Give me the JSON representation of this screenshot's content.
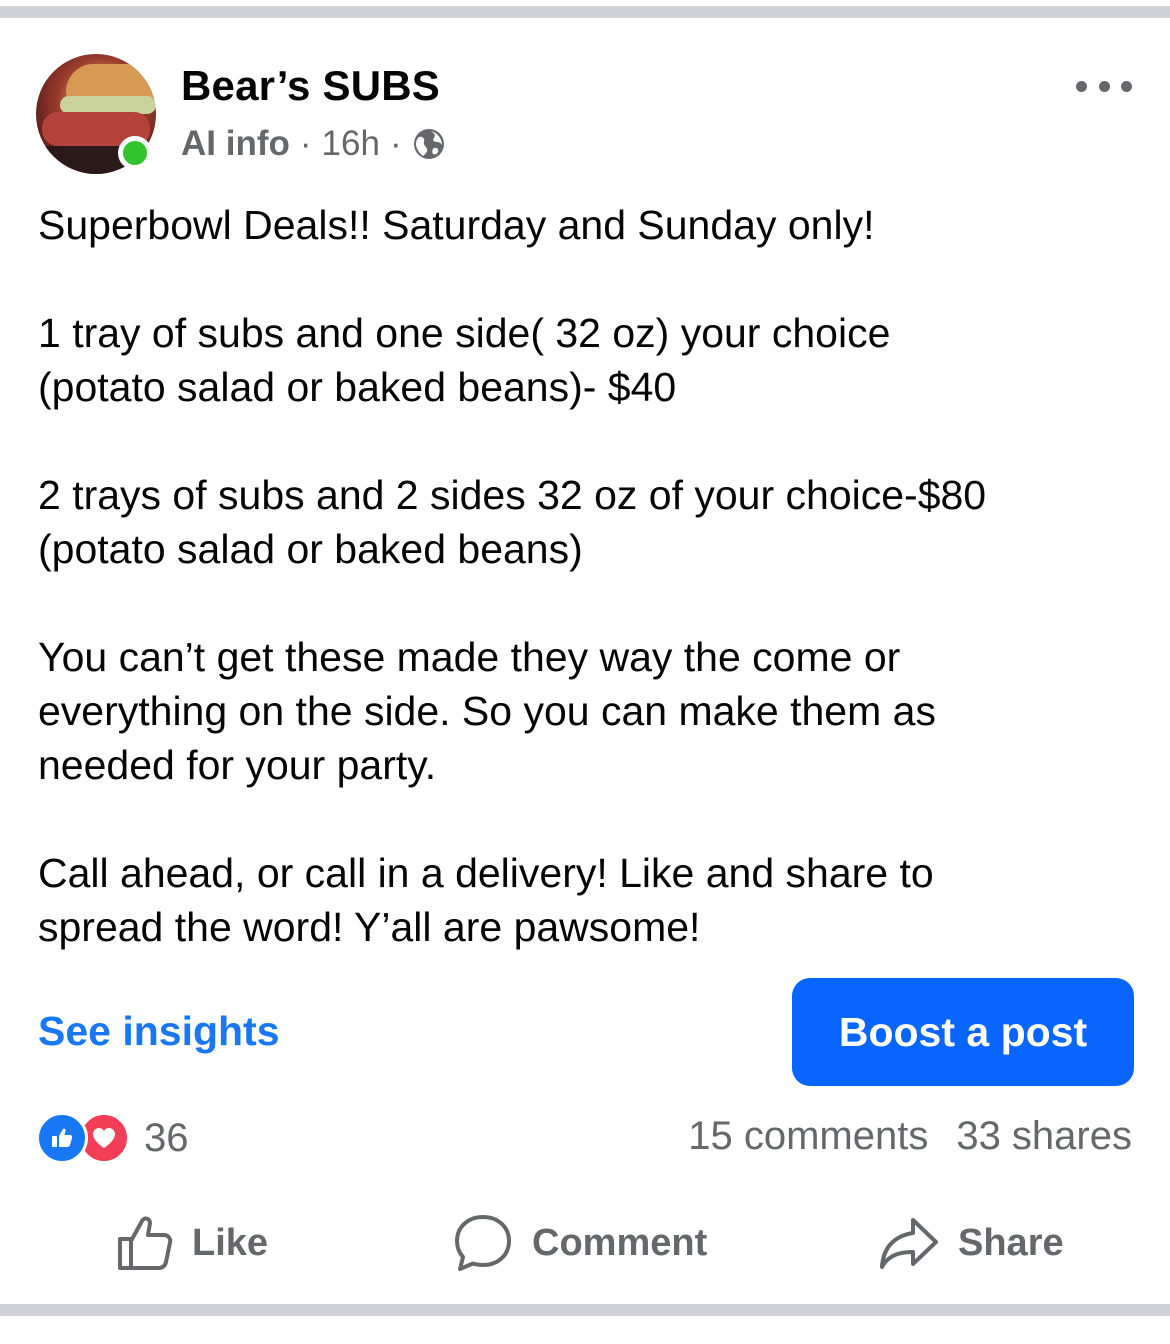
{
  "post": {
    "page_name": "Bear’s SUBS",
    "meta": {
      "ai_info": "AI info",
      "separator": "·",
      "time": "16h",
      "audience_icon": "globe-icon"
    },
    "body": [
      "Superbowl Deals!! Saturday and Sunday only!",
      "1 tray of subs and one side( 32 oz) your choice\n(potato salad or baked beans)- $40",
      "2 trays of subs and 2 sides 32 oz of your choice-$80\n(potato salad or baked beans)",
      "You can’t get these made they way the come or\neverything on the side. So you can make them as\nneeded for your party.",
      "Call ahead, or call in a delivery! Like and share to\nspread the word! Y’all are pawsome!"
    ],
    "see_insights": "See insights",
    "boost_button": "Boost a post",
    "reaction_count": "36",
    "comments_count": "15 comments",
    "shares_count": "33 shares"
  },
  "actions": {
    "like": "Like",
    "comment": "Comment",
    "share": "Share"
  },
  "colors": {
    "accent": "#1877f2",
    "boost": "#0866ff",
    "online": "#31c42c",
    "love": "#f33e58",
    "secondary_text": "#65676b"
  }
}
